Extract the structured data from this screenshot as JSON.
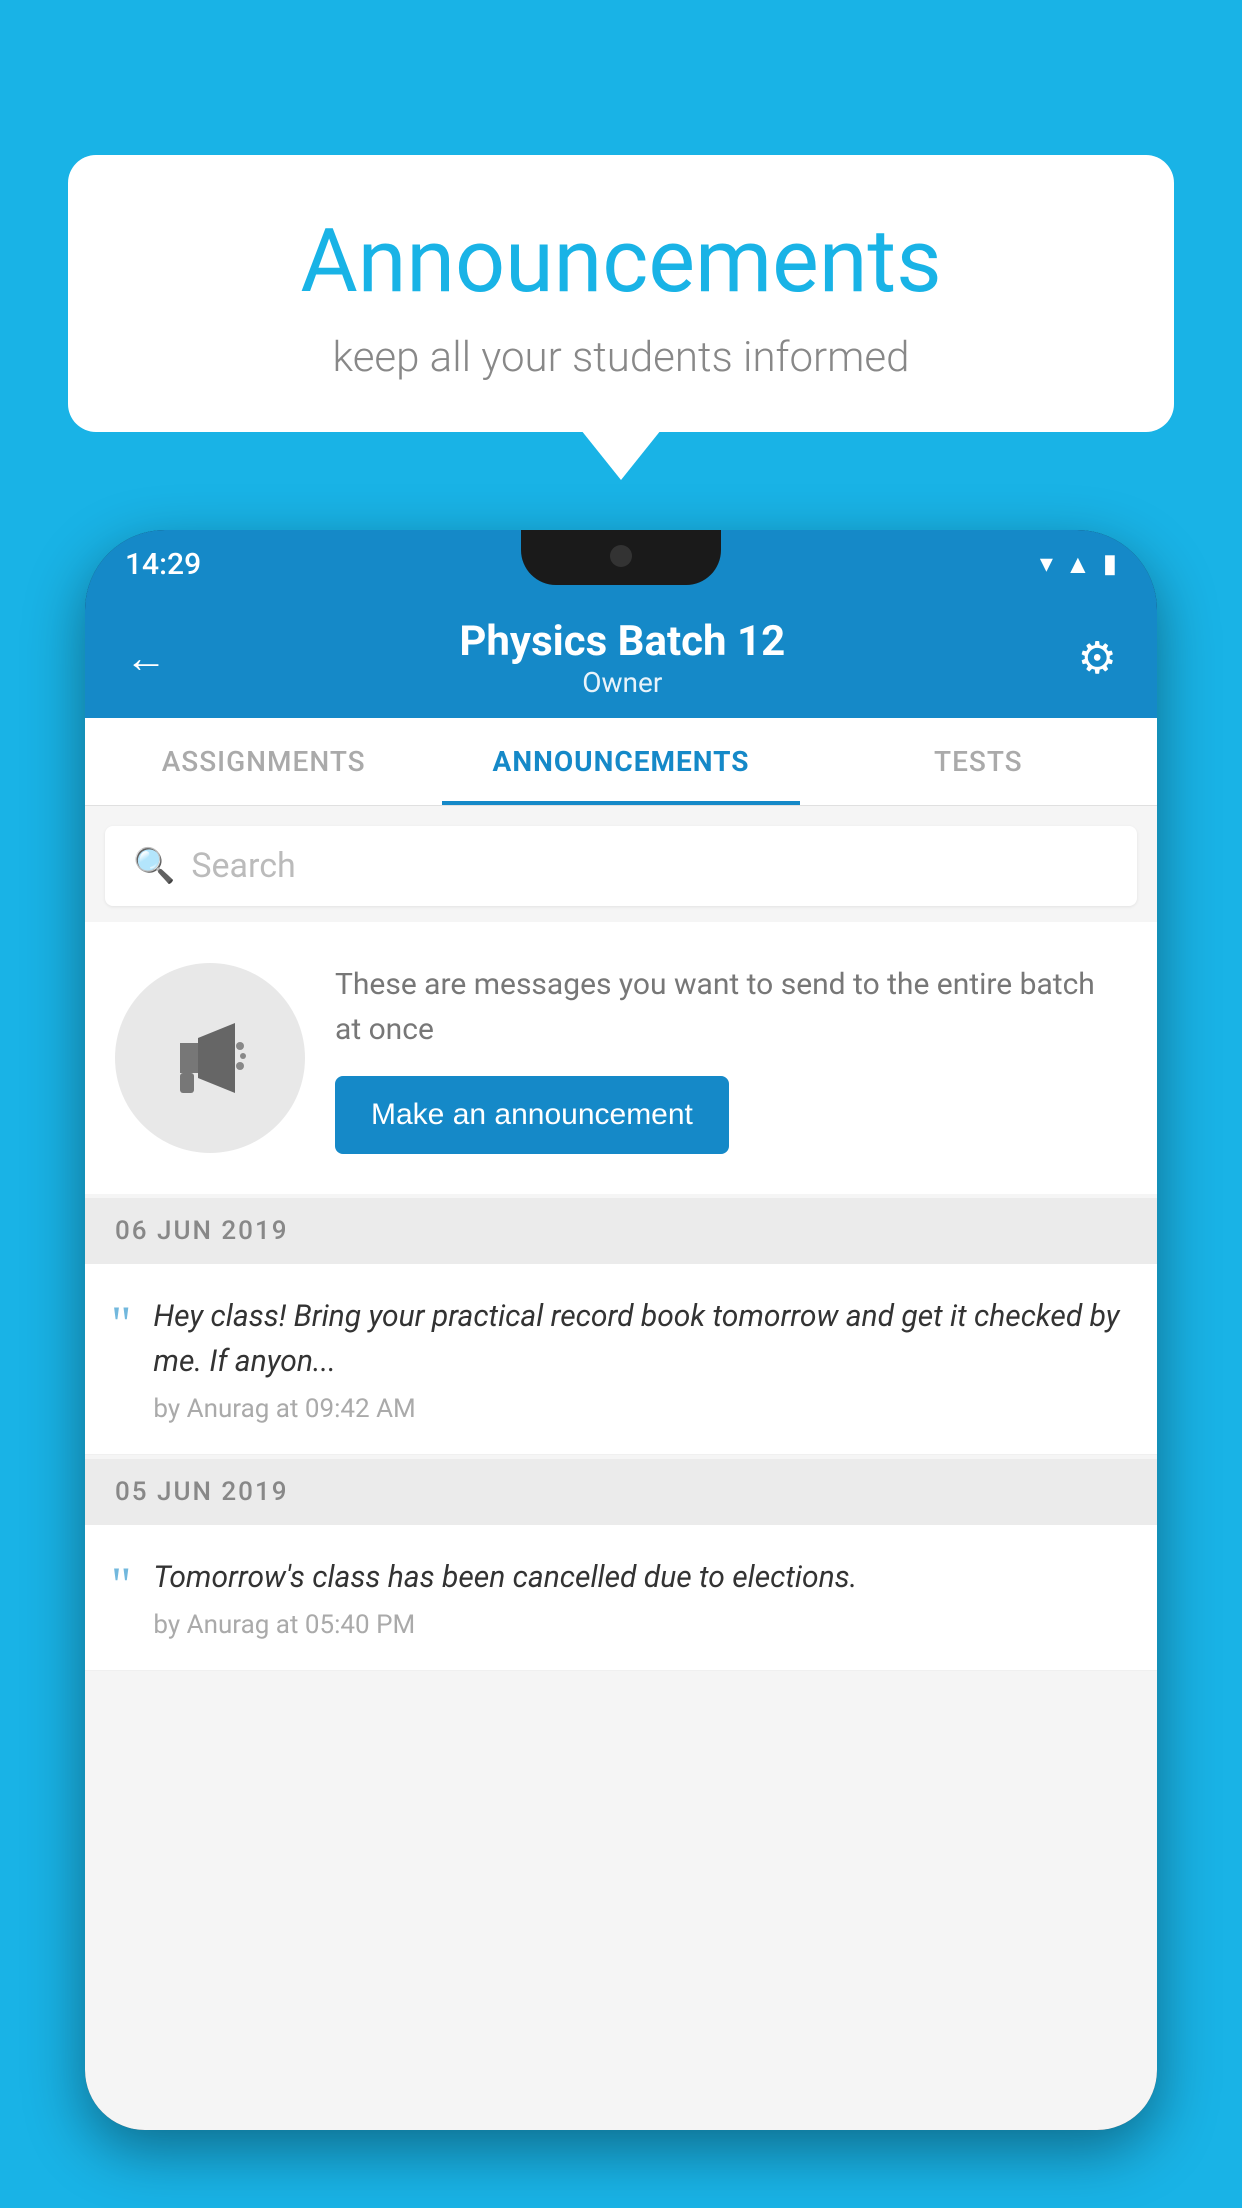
{
  "bubble": {
    "title": "Announcements",
    "subtitle": "keep all your students informed"
  },
  "status_bar": {
    "time": "14:29",
    "wifi": "▼",
    "signal": "▲",
    "battery": "▐"
  },
  "header": {
    "title": "Physics Batch 12",
    "subtitle": "Owner",
    "back_label": "←",
    "gear_label": "⚙"
  },
  "tabs": [
    {
      "label": "ASSIGNMENTS",
      "active": false
    },
    {
      "label": "ANNOUNCEMENTS",
      "active": true
    },
    {
      "label": "TESTS",
      "active": false
    },
    {
      "label": "...",
      "active": false
    }
  ],
  "search": {
    "placeholder": "Search"
  },
  "promo": {
    "text": "These are messages you want to send to the entire batch at once",
    "button_label": "Make an announcement"
  },
  "announcements": [
    {
      "date": "06  JUN  2019",
      "text": "Hey class! Bring your practical record book tomorrow and get it checked by me. If anyon...",
      "meta": "by Anurag at 09:42 AM"
    },
    {
      "date": "05  JUN  2019",
      "text": "Tomorrow's class has been cancelled due to elections.",
      "meta": "by Anurag at 05:40 PM"
    }
  ],
  "colors": {
    "brand_blue": "#1589c8",
    "background_blue": "#19b3e6"
  }
}
